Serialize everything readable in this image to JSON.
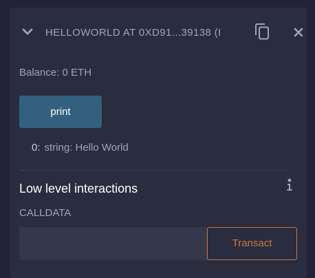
{
  "contract": {
    "title": "HELLOWORLD AT 0XD91...39138 (I",
    "balance": "Balance: 0 ETH"
  },
  "functions": {
    "print_label": "print",
    "output_index": "0:",
    "output_value": "string: Hello World"
  },
  "low_level": {
    "title": "Low level interactions",
    "calldata_label": "CALLDATA",
    "calldata_value": "",
    "transact_label": "Transact"
  },
  "icons": {
    "expand": "chevron-down-icon",
    "copy": "copy-icon",
    "close": "close-icon",
    "info": "info-icon"
  },
  "colors": {
    "accent_button": "#34607f",
    "transact": "#d1783d",
    "panel": "#2a2c3f",
    "background": "#222336"
  }
}
